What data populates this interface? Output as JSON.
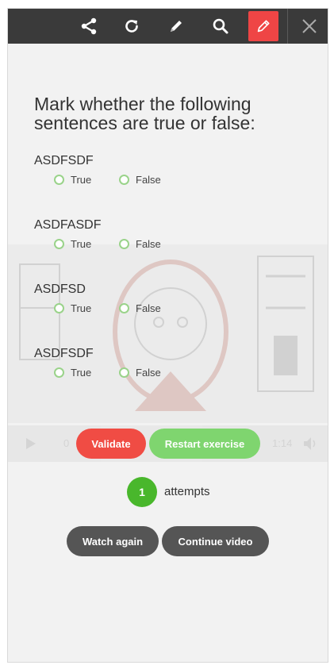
{
  "toolbar": {
    "share_icon": "share-icon",
    "refresh_icon": "refresh-icon",
    "pen_icon": "pen-icon",
    "search_icon": "search-icon",
    "edit_icon": "pencil-edit-icon",
    "close_icon": "close-icon",
    "active_color": "#ef4545"
  },
  "exercise": {
    "instruction": "Mark whether the following sentences are true or false:",
    "questions": [
      {
        "text": "ASDFSDF",
        "true_label": "True",
        "false_label": "False"
      },
      {
        "text": "ASDFASDF",
        "true_label": "True",
        "false_label": "False"
      },
      {
        "text": "ASDFSD",
        "true_label": "True",
        "false_label": "False"
      },
      {
        "text": "ASDFSDF",
        "true_label": "True",
        "false_label": "False"
      }
    ]
  },
  "video_background": {
    "left_time": "0",
    "right_time": "1:14"
  },
  "actions": {
    "validate_label": "Validate",
    "restart_label": "Restart exercise",
    "watch_again_label": "Watch again",
    "continue_label": "Continue video"
  },
  "attempts": {
    "count": "1",
    "label": "attempts"
  },
  "colors": {
    "validate": "#f04c44",
    "restart": "#7fd56f",
    "badge": "#49b72c",
    "dark_button": "#555555"
  }
}
